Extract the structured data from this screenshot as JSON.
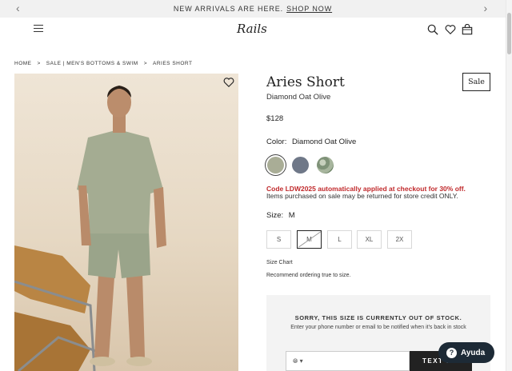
{
  "promo_bar": {
    "text": "NEW ARRIVALS ARE HERE.",
    "link": "SHOP NOW"
  },
  "header": {
    "logo": "Rails"
  },
  "breadcrumb": [
    "HOME",
    ">",
    "SALE | MEN'S BOTTOMS & SWIM",
    ">",
    "ARIES SHORT"
  ],
  "product": {
    "title": "Aries Short",
    "subtitle": "Diamond Oat Olive",
    "badge": "Sale",
    "price": "$128",
    "color_label": "Color:",
    "color_value": "Diamond Oat Olive",
    "swatches": [
      {
        "name": "Diamond Oat Olive",
        "color": "#a9ad96",
        "selected": true
      },
      {
        "name": "Slate",
        "color": "#6f7888",
        "selected": false
      },
      {
        "name": "Green Print",
        "color": "#8e9e89",
        "selected": false
      }
    ],
    "promo_code": "Code LDW2025 automatically applied at checkout for 30% off.",
    "promo_note": "Items purchased on sale may be returned for store credit ONLY.",
    "size_label": "Size:",
    "size_value": "M",
    "sizes": [
      "S",
      "M",
      "L",
      "XL",
      "2X"
    ],
    "size_chart": "Size Chart",
    "size_rec": "Recommend ordering true to size."
  },
  "notify": {
    "title": "SORRY, THIS SIZE IS CURRENTLY OUT OF STOCK.",
    "text": "Enter your phone number or email to be notified when it's back in stock",
    "button": "TEXT ME"
  },
  "help_button": "Ayuda",
  "colors": {
    "sale_red": "#c0292b",
    "help_bg": "#1d2a36"
  }
}
